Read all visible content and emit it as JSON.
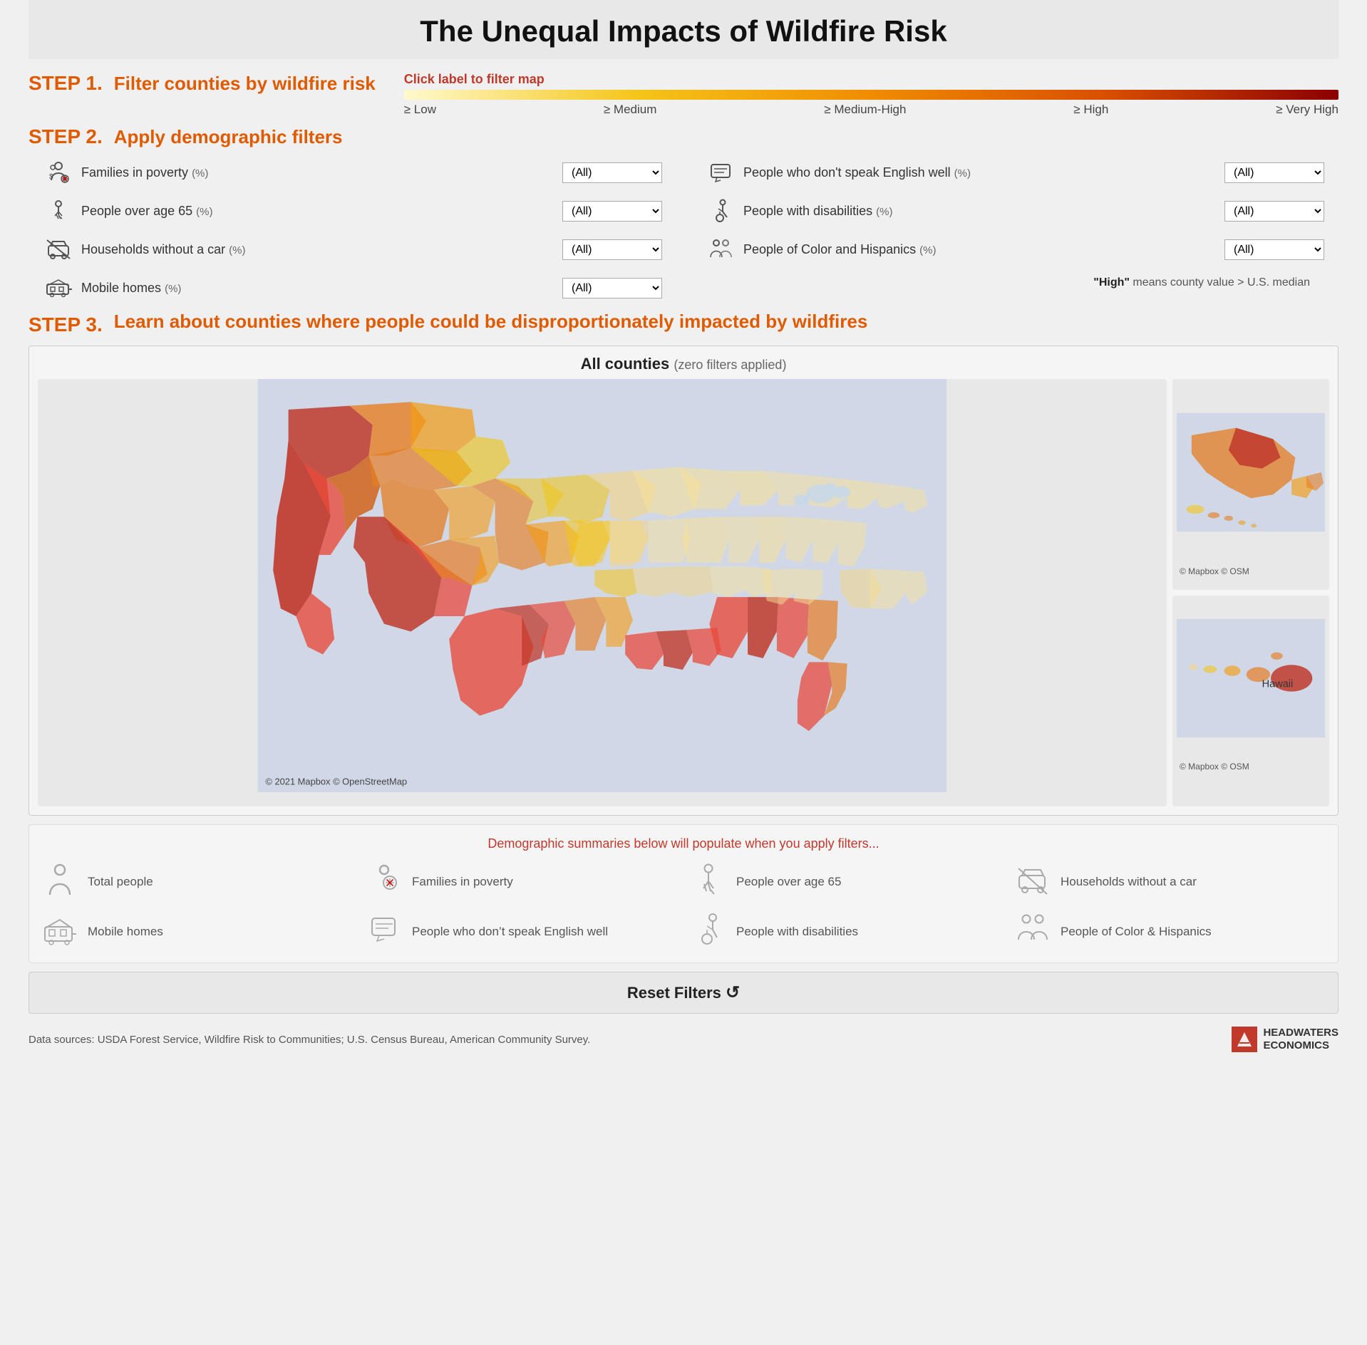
{
  "title": "The Unequal Impacts of Wildfire Risk",
  "step1": {
    "label": "STEP 1.",
    "description": "Filter counties by wildfire risk",
    "click_label": "Click label to filter map",
    "filter_levels": [
      {
        "label": "≥ Low"
      },
      {
        "label": "≥ Medium"
      },
      {
        "label": "≥ Medium-High"
      },
      {
        "label": "≥ High"
      },
      {
        "label": "≥ Very High"
      }
    ]
  },
  "step2": {
    "label": "STEP 2.",
    "description": "Apply demographic filters",
    "filters_left": [
      {
        "label": "Families in poverty",
        "pct": "(%)",
        "value": "(All)"
      },
      {
        "label": "People over age 65",
        "pct": "(%)",
        "value": "(All)"
      },
      {
        "label": "Households without a car",
        "pct": "(%)",
        "value": "(All)"
      },
      {
        "label": "Mobile homes",
        "pct": "(%)",
        "value": "(All)"
      }
    ],
    "filters_right": [
      {
        "label": "People who don't speak English well",
        "pct": "(%)",
        "value": "(All)"
      },
      {
        "label": "People with disabilities",
        "pct": "(%)",
        "value": "(All)"
      },
      {
        "label": "People of Color and Hispanics",
        "pct": "(%)",
        "value": "(All)"
      }
    ],
    "median_note_prefix": "“High” means county value > U.S. median",
    "high_text": "\"High\"",
    "median_text": "means county value > U.S. median"
  },
  "step3": {
    "label": "STEP 3.",
    "description": "Learn about counties where people could be disproportionately impacted by wildfires"
  },
  "map": {
    "title": "All counties",
    "filter_note": "(zero filters applied)",
    "credit": "© 2021 Mapbox  © OpenStreetMap",
    "credit_side": "© Mapbox  © OSM",
    "hawaii_label": "Hawaii"
  },
  "demo_summary": {
    "message": "Demographic summaries below will populate when you apply filters...",
    "items": [
      {
        "label": "Total people"
      },
      {
        "label": "Families in poverty"
      },
      {
        "label": "People over age 65"
      },
      {
        "label": "Households without a car"
      },
      {
        "label": "Mobile homes"
      },
      {
        "label": "People who don’t speak English well"
      },
      {
        "label": "People with disabilities"
      },
      {
        "label": "People of Color & Hispanics"
      }
    ]
  },
  "reset": {
    "label": "Reset Filters",
    "icon": "↺"
  },
  "footer": {
    "data_sources": "Data sources: USDA Forest Service, Wildfire Risk to Communities; U.S. Census Bureau, American Community Survey.",
    "brand_line1": "HEADWATERS",
    "brand_line2": "ECONOMICS"
  }
}
